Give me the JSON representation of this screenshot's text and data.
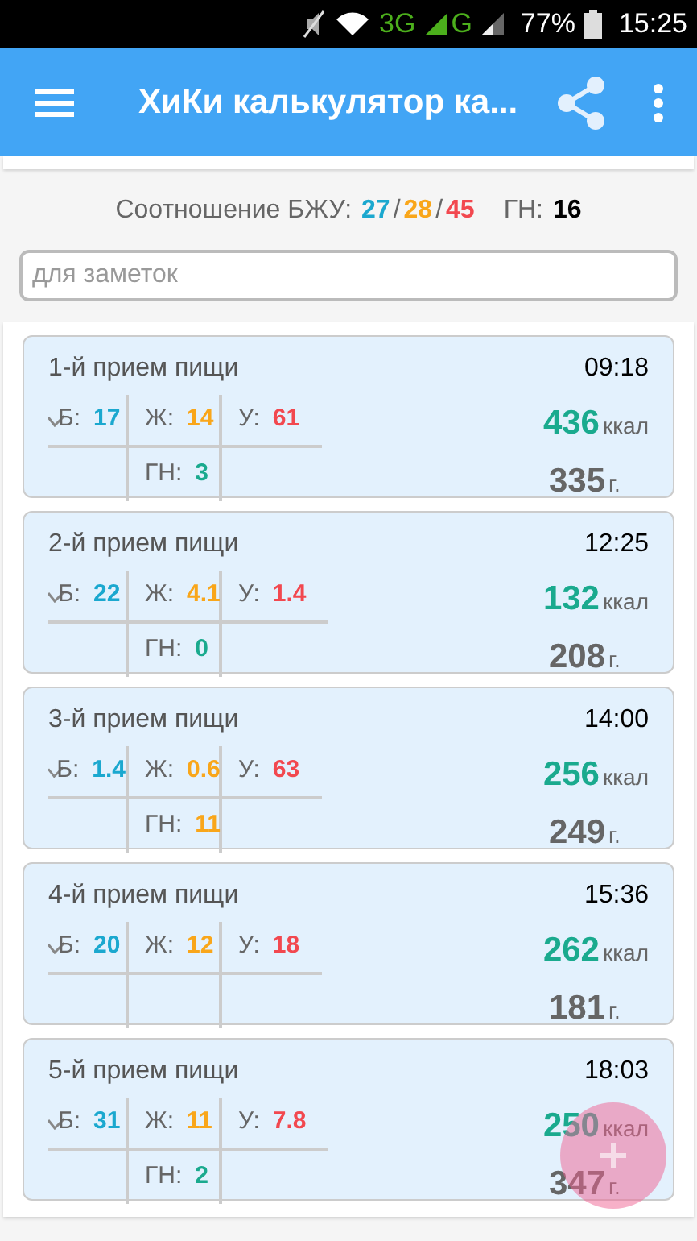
{
  "status_bar": {
    "network_1": "3G",
    "network_2": "G",
    "battery": "77%",
    "time": "15:25"
  },
  "app_bar": {
    "title": "ХиКи калькулятор ка..."
  },
  "summary": {
    "label": "Соотношение БЖУ:",
    "protein": "27",
    "fat": "28",
    "carbs": "45",
    "separator_1": "/",
    "separator_2": "/",
    "gn_label": "ГН:",
    "gn": "16"
  },
  "notes": {
    "placeholder": "для заметок"
  },
  "meals": [
    {
      "title": "1-й прием пищи",
      "time": "09:18",
      "protein_label": "Б:",
      "protein": "17",
      "fat_label": "Ж:",
      "fat": "14",
      "carbs_label": "У:",
      "carbs": "61",
      "gn": {
        "label": "ГН:",
        "value": "3",
        "color": "#1aaa8e"
      },
      "kcal": "436",
      "kcal_unit": "ккал",
      "grams": "335",
      "grams_unit": "г."
    },
    {
      "title": "2-й прием пищи",
      "time": "12:25",
      "protein_label": "Б:",
      "protein": "22",
      "fat_label": "Ж:",
      "fat": "4.1",
      "carbs_label": "У:",
      "carbs": "1.4",
      "gn": {
        "label": "ГН:",
        "value": "0",
        "color": "#1aaa8e"
      },
      "kcal": "132",
      "kcal_unit": "ккал",
      "grams": "208",
      "grams_unit": "г."
    },
    {
      "title": "3-й прием пищи",
      "time": "14:00",
      "protein_label": "Б:",
      "protein": "1.4",
      "fat_label": "Ж:",
      "fat": "0.6",
      "carbs_label": "У:",
      "carbs": "63",
      "gn": {
        "label": "ГН:",
        "value": "11",
        "color": "#f9a61a"
      },
      "kcal": "256",
      "kcal_unit": "ккал",
      "grams": "249",
      "grams_unit": "г."
    },
    {
      "title": "4-й прием пищи",
      "time": "15:36",
      "protein_label": "Б:",
      "protein": "20",
      "fat_label": "Ж:",
      "fat": "12",
      "carbs_label": "У:",
      "carbs": "18",
      "kcal": "262",
      "kcal_unit": "ккал",
      "grams": "181",
      "grams_unit": "г."
    },
    {
      "title": "5-й прием пищи",
      "time": "18:03",
      "protein_label": "Б:",
      "protein": "31",
      "fat_label": "Ж:",
      "fat": "11",
      "carbs_label": "У:",
      "carbs": "7.8",
      "gn": {
        "label": "ГН:",
        "value": "2",
        "color": "#1aaa8e"
      },
      "kcal": "250",
      "kcal_unit": "ккал",
      "grams": "347",
      "grams_unit": "г."
    }
  ]
}
